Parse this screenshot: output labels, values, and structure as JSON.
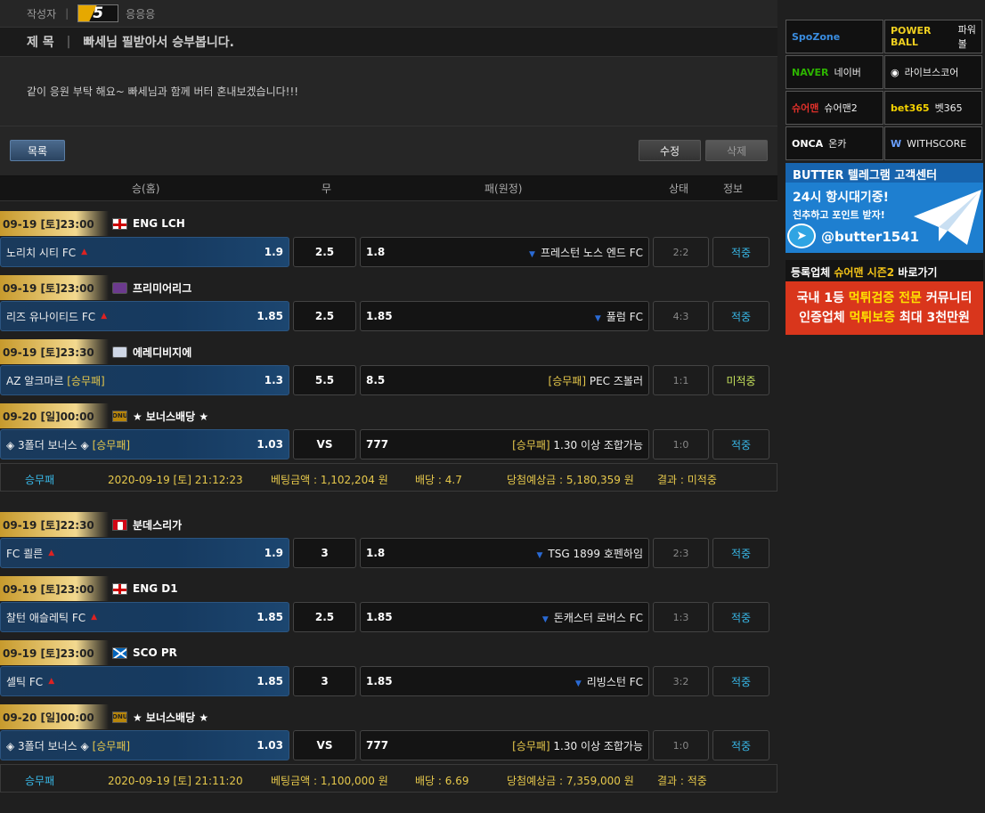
{
  "post": {
    "author_label": "작성자",
    "author_level": "5",
    "author_name": "응응응",
    "title_label": "제 목",
    "title": "빠세님 필받아서 승부봅니다.",
    "body": "같이 응원 부탁 해요~ 빠세님과 함께 버터 혼내보겠습니다!!!"
  },
  "buttons": {
    "list": "목록",
    "edit": "수정",
    "delete": "삭제"
  },
  "table_headers": {
    "home": "승(홈)",
    "draw": "무",
    "away": "패(원정)",
    "status": "상태",
    "info": "정보"
  },
  "tickets": [
    {
      "games": [
        {
          "date": "09-19 [토]23:00",
          "league": "ENG LCH",
          "flag": "eng",
          "home": "노리치 시티 FC",
          "home_odd": "1.9",
          "draw": "2.5",
          "away_odd": "1.8",
          "away": "프레스턴 노스 엔드 FC",
          "score": "2:2",
          "result": "적중"
        },
        {
          "date": "09-19 [토]23:00",
          "league": "프리미어리그",
          "flag": "epl",
          "home": "리즈 유나이티드 FC",
          "home_odd": "1.85",
          "draw": "2.5",
          "away_odd": "1.85",
          "away": "풀럼 FC",
          "score": "4:3",
          "result": "적중"
        },
        {
          "date": "09-19 [토]23:30",
          "league": "에레디비지에",
          "flag": "ere",
          "home": "AZ 알크마르",
          "home_tag": "[승무패]",
          "home_odd": "1.3",
          "draw": "5.5",
          "away_odd": "8.5",
          "away_tag": "[승무패]",
          "away": "PEC 즈볼러",
          "score": "1:1",
          "result": "미적중"
        },
        {
          "date": "09-20 [일]00:00",
          "league": "★ 보너스배당 ★",
          "flag": "bonus",
          "home": "◈ 3폴더 보너스 ◈",
          "home_tag": "[승무패]",
          "home_odd": "1.03",
          "draw": "VS",
          "away_odd": "777",
          "away_tag": "[승무패]",
          "away": "1.30 이상 조합가능",
          "score": "1:0",
          "result": "적중"
        }
      ],
      "summary": {
        "type": "승무패",
        "datetime": "2020-09-19 [토] 21:12:23",
        "bet": "베팅금액 : 1,102,204 원",
        "odds": "배당 : 4.7",
        "expected": "당첨예상금 : 5,180,359 원",
        "result": "결과 : 미적중"
      }
    },
    {
      "games": [
        {
          "date": "09-19 [토]22:30",
          "league": "분데스리가",
          "flag": "bund",
          "home": "FC 쾰른",
          "home_odd": "1.9",
          "draw": "3",
          "away_odd": "1.8",
          "away": "TSG 1899 호펜하임",
          "score": "2:3",
          "result": "적중"
        },
        {
          "date": "09-19 [토]23:00",
          "league": "ENG D1",
          "flag": "eng",
          "home": "찰턴 애슬레틱 FC",
          "home_odd": "1.85",
          "draw": "2.5",
          "away_odd": "1.85",
          "away": "돈캐스터 로버스 FC",
          "score": "1:3",
          "result": "적중"
        },
        {
          "date": "09-19 [토]23:00",
          "league": "SCO PR",
          "flag": "sco",
          "home": "셀틱 FC",
          "home_odd": "1.85",
          "draw": "3",
          "away_odd": "1.85",
          "away": "리빙스턴 FC",
          "score": "3:2",
          "result": "적중"
        },
        {
          "date": "09-20 [일]00:00",
          "league": "★ 보너스배당 ★",
          "flag": "bonus",
          "home": "◈ 3폴더 보너스 ◈",
          "home_tag": "[승무패]",
          "home_odd": "1.03",
          "draw": "VS",
          "away_odd": "777",
          "away_tag": "[승무패]",
          "away": "1.30 이상 조합가능",
          "score": "1:0",
          "result": "적중"
        }
      ],
      "summary": {
        "type": "승무패",
        "datetime": "2020-09-19 [토] 21:11:20",
        "bet": "베팅금액 : 1,100,000 원",
        "odds": "배당 : 6.69",
        "expected": "당첨예상금 : 7,359,000 원",
        "result": "결과 : 적중"
      }
    }
  ],
  "sponsors": [
    {
      "logo": "SpoZone",
      "label": "",
      "color": "#3a8de0"
    },
    {
      "logo": "POWER BALL",
      "label": "파워볼",
      "color": "#f0d020"
    },
    {
      "logo": "NAVER",
      "label": "네이버",
      "color": "#2db400"
    },
    {
      "logo": "◉",
      "label": "라이브스코어",
      "color": "#ffffff"
    },
    {
      "logo": "슈어맨",
      "label": "슈어맨2",
      "color": "#e0302a"
    },
    {
      "logo": "bet365",
      "label": "벳365",
      "color": "#f5d300"
    },
    {
      "logo": "ONCA",
      "label": "온카",
      "color": "#ffffff"
    },
    {
      "logo": "W",
      "label": "WITHSCORE",
      "color": "#6aa0ff"
    }
  ],
  "banner1": {
    "head": "BUTTER 텔레그램 고객센터",
    "line1": "24시 항시대기중!",
    "line2": "친추하고 포인트 받자!",
    "handle": "@butter1541"
  },
  "banner2": {
    "head_a": "등록업체",
    "head_b": "슈어맨 시즌2",
    "head_c": "바로가기",
    "line1_a": "국내 1등",
    "line1_b": "먹튀검증 전문",
    "line1_c": "커뮤니티",
    "line2_a": "인증업체",
    "line2_b": "먹튀보증",
    "line2_c": "최대 3천만원"
  }
}
